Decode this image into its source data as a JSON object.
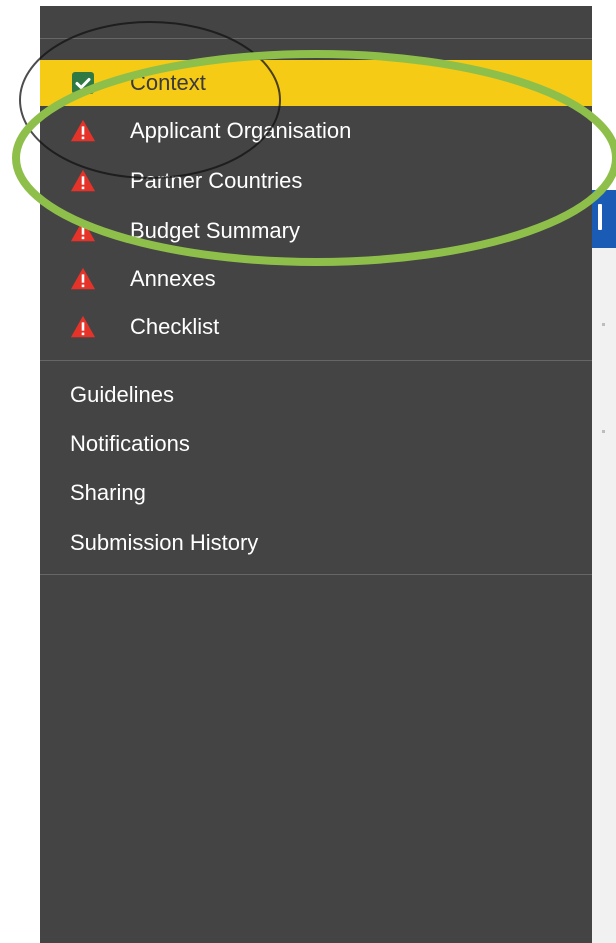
{
  "sidebar": {
    "sections": [
      {
        "label": "Context",
        "status": "complete",
        "active": true
      },
      {
        "label": "Applicant Organisation",
        "status": "warning",
        "active": false
      },
      {
        "label": "Partner Countries",
        "status": "warning",
        "active": false
      },
      {
        "label": "Budget Summary",
        "status": "warning",
        "active": false
      },
      {
        "label": "Annexes",
        "status": "warning",
        "active": false
      },
      {
        "label": "Checklist",
        "status": "warning",
        "active": false
      }
    ],
    "links": [
      {
        "label": "Guidelines"
      },
      {
        "label": "Notifications"
      },
      {
        "label": "Sharing"
      },
      {
        "label": "Submission History"
      }
    ]
  },
  "icons": {
    "complete": "check-square-icon",
    "warning": "warning-triangle-icon"
  },
  "colors": {
    "sidebar_bg": "#444444",
    "active_bg": "#f5cb16",
    "warning": "#e5332a",
    "check": "#2f7a44",
    "highlight_ellipse": "#8fbf4b",
    "right_bar": "#1a5cb5"
  }
}
